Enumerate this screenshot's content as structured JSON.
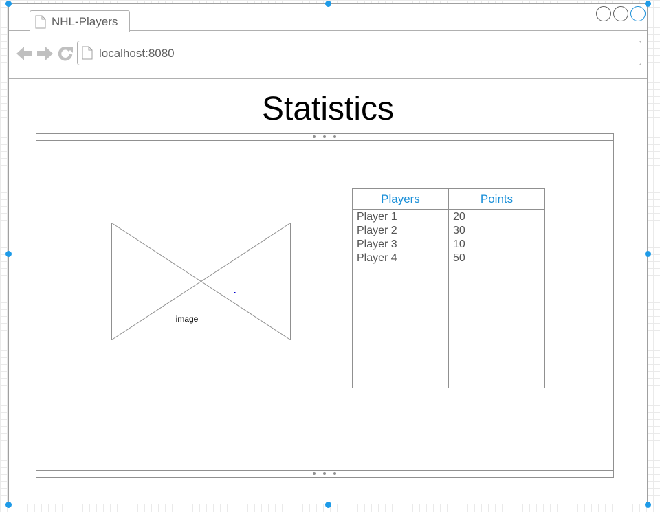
{
  "browser": {
    "tab_title": "NHL-Players",
    "url": "localhost:8080"
  },
  "page": {
    "title": "Statistics"
  },
  "image_placeholder": {
    "label": "image"
  },
  "stats_table": {
    "headers": [
      "Players",
      "Points"
    ],
    "players": [
      "Player 1",
      "Player 2",
      "Player 3",
      "Player 4"
    ],
    "points": [
      "20",
      "30",
      "10",
      "50"
    ]
  },
  "colors": {
    "accent": "#1a8fd8",
    "border": "#909090",
    "text_gray": "#555555",
    "selection_handle": "#1e9be8"
  },
  "icons": [
    "document-icon",
    "back-arrow-icon",
    "forward-arrow-icon",
    "refresh-icon",
    "window-button-icon"
  ]
}
